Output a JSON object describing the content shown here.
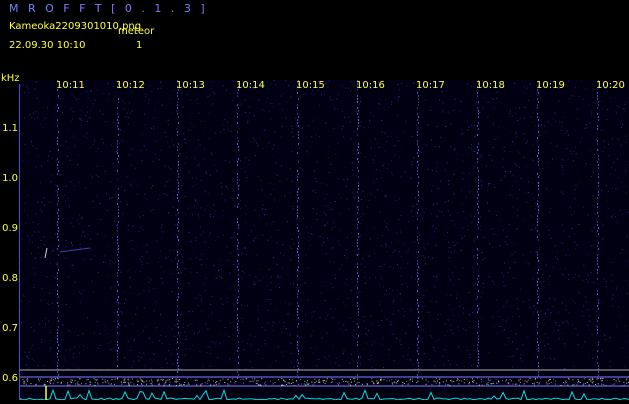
{
  "header": {
    "app_title": "M R O F F T  [ 0 . 1 . 3 ]",
    "filename": "Kameoka2209301010.png",
    "meteor_label": "meteor",
    "datetime": "22.09.30  10:10",
    "meteor_count": "1"
  },
  "frequency_axis": {
    "unit": "kHz",
    "ticks": [
      "1.1",
      "1.0",
      "0.9",
      "0.8",
      "0.7",
      "0.6"
    ]
  },
  "time_axis": {
    "ticks": [
      "10:11",
      "10:12",
      "10:13",
      "10:14",
      "10:15",
      "10:16",
      "10:17",
      "10:18",
      "10:19",
      "10:20"
    ]
  },
  "colors": {
    "label": "#ffff40",
    "title": "#7c7cff",
    "background": "#000012",
    "noise_dot": "#3b3bc8",
    "activity_trace": "#00e0e0",
    "band_line": "#b0b0b0"
  }
}
